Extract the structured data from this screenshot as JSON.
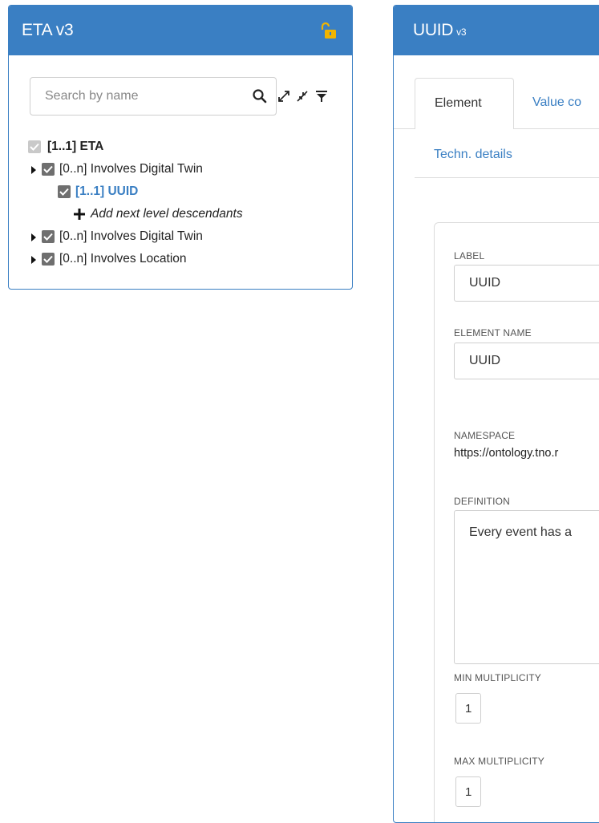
{
  "left_panel": {
    "title": "ETA v3",
    "search": {
      "placeholder": "Search by name",
      "value": ""
    },
    "icons": [
      "unlock-icon",
      "search-icon",
      "expand-icon",
      "collapse-icon",
      "filter-icon"
    ],
    "tree": [
      {
        "label": "[1..1] ETA",
        "checked": true,
        "disabled": true,
        "expandable": false
      },
      {
        "label": "[0..n] Involves Digital Twin",
        "checked": true,
        "expandable": true
      },
      {
        "label": "[1..1] UUID",
        "checked": true,
        "selected": true,
        "expandable": false
      },
      {
        "label": "Add next level descendants",
        "action": true
      },
      {
        "label": "[0..n] Involves Digital Twin",
        "checked": true,
        "expandable": true
      },
      {
        "label": "[0..n] Involves Location",
        "checked": true,
        "expandable": true
      }
    ]
  },
  "right_panel": {
    "title": "UUID",
    "version": "v3",
    "tabs": {
      "element": "Element",
      "value": "Value co",
      "techn": "Techn. details"
    },
    "form": {
      "label_label": "LABEL",
      "label_value": "UUID",
      "element_name_label": "ELEMENT NAME",
      "element_name_value": "UUID",
      "namespace_label": "NAMESPACE",
      "namespace_value": "https://ontology.tno.r",
      "definition_label": "DEFINITION",
      "definition_value": "Every event has a",
      "min_label": "MIN MULTIPLICITY",
      "min_value": "1",
      "max_label": "MAX MULTIPLICITY",
      "max_value": "1"
    }
  },
  "colors": {
    "header": "#3a7fc3",
    "lock": "#f0b400",
    "link": "#3a7fc3"
  }
}
